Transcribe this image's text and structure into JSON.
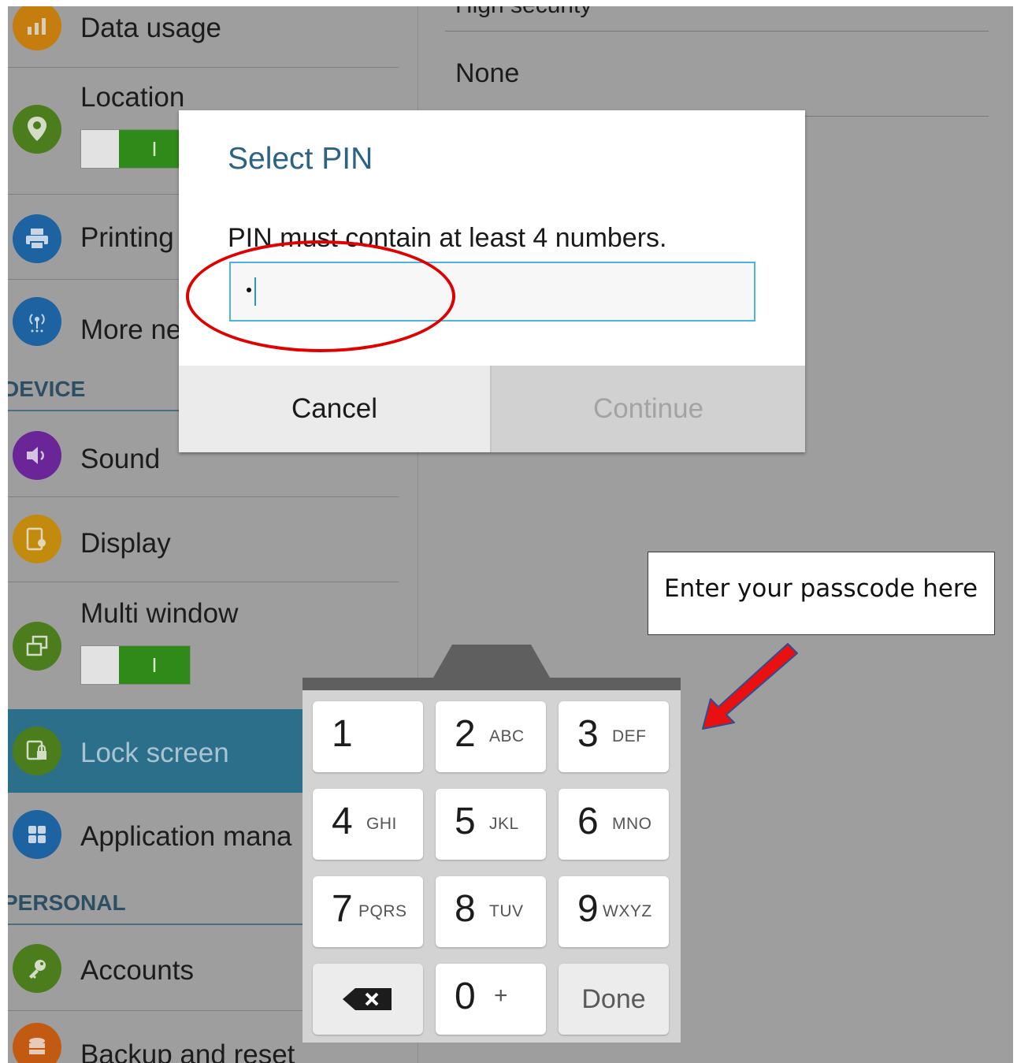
{
  "settings_list": {
    "data_usage": "Data usage",
    "location": "Location",
    "printing": "Printing",
    "more_networks": "More ne",
    "device_header": "DEVICE",
    "sound": "Sound",
    "display": "Display",
    "multi_window": "Multi window",
    "lock_screen": "Lock screen",
    "application_manager": "Application mana",
    "personal_header": "PERSONAL",
    "accounts": "Accounts",
    "backup_reset": "Backup and reset",
    "toggle_on_glyph": "I"
  },
  "right_pane": {
    "previous_option": "High security",
    "none_option": "None"
  },
  "dialog": {
    "title": "Select PIN",
    "message": "PIN must contain at least 4 numbers.",
    "cancel": "Cancel",
    "continue": "Continue"
  },
  "callout": {
    "text": "Enter your passcode here"
  },
  "keypad": {
    "keys": [
      {
        "digit": "1",
        "letters": ""
      },
      {
        "digit": "2",
        "letters": "ABC"
      },
      {
        "digit": "3",
        "letters": "DEF"
      },
      {
        "digit": "4",
        "letters": "GHI"
      },
      {
        "digit": "5",
        "letters": "JKL"
      },
      {
        "digit": "6",
        "letters": "MNO"
      },
      {
        "digit": "7",
        "letters": "PQRS"
      },
      {
        "digit": "8",
        "letters": "TUV"
      },
      {
        "digit": "9",
        "letters": "WXYZ"
      }
    ],
    "zero": "0",
    "plus": "+",
    "done": "Done"
  },
  "colors": {
    "dialog_title": "#2c6384",
    "input_border": "#4fb3d9",
    "highlight": "#e00000",
    "toggle_on": "#2f8a1a",
    "selected_item": "#2b6f8b"
  }
}
